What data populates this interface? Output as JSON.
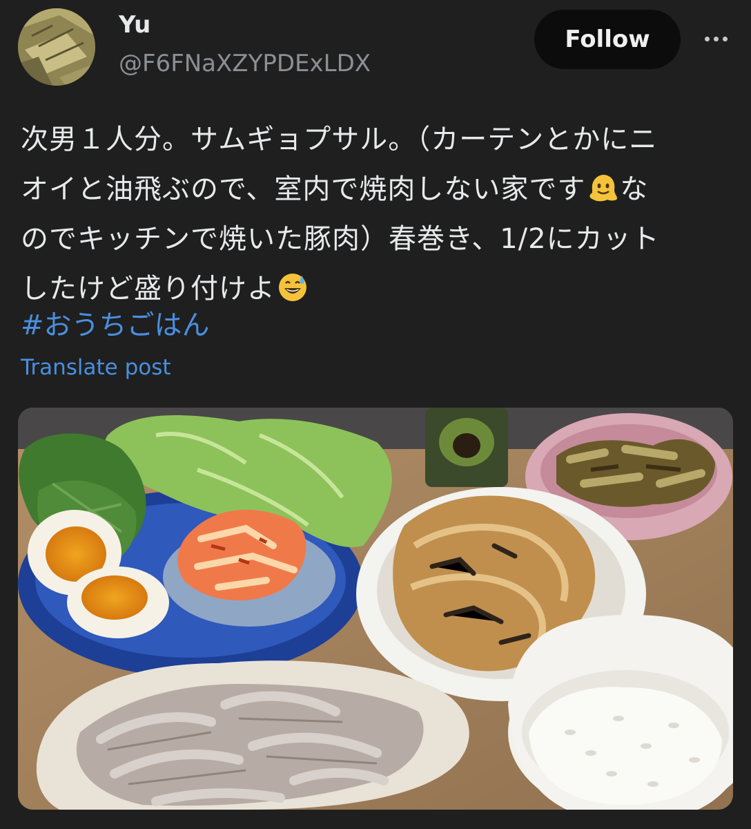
{
  "author": {
    "display_name": "Yu",
    "handle": "@F6FNaXZYPDExLDX"
  },
  "actions": {
    "follow_label": "Follow",
    "more_icon": "more-horizontal-icon"
  },
  "post": {
    "lines": [
      "次男１人分。サムギョプサル。（カーテンとかにニ",
      "オイと油飛ぶので、室内で焼肉しない家です",
      "なのでキッチンで焼いた豚肉）春巻き、1/2にカット",
      "したけど盛り付けよ"
    ],
    "line2_tail": "な",
    "line3_head": "のでキッチンで焼いた豚肉）春巻き、1/2にカット",
    "hashtag": "#おうちごはん",
    "translate_label": "Translate post"
  },
  "emojis": {
    "melting_face": "melting-face-emoji",
    "sweat_smile": "grinning-face-with-sweat-emoji"
  },
  "colors": {
    "background": "#1f1f1f",
    "link": "#4a8fe0",
    "follow_bg": "#0c0c0c",
    "secondary_text": "#8b9096"
  }
}
